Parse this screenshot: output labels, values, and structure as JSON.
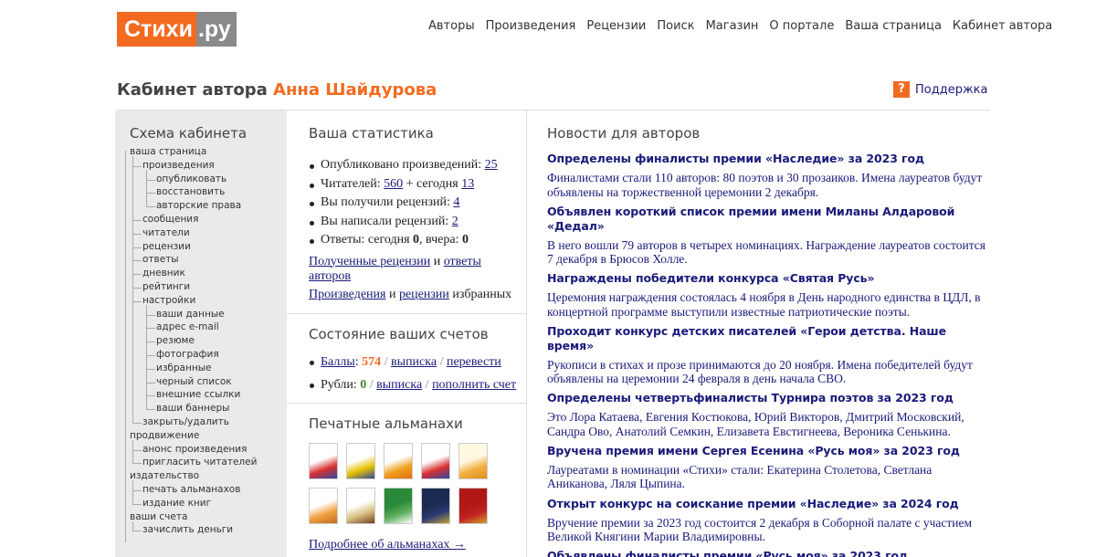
{
  "logo": {
    "part1": "Стихи",
    "part2": ".ру"
  },
  "nav": [
    "Авторы",
    "Произведения",
    "Рецензии",
    "Поиск",
    "Магазин",
    "О портале",
    "Ваша страница",
    "Кабинет автора"
  ],
  "cabinet": {
    "prefix": "Кабинет автора ",
    "author": "Анна Шайдурова"
  },
  "support": {
    "icon": "?",
    "label": "Поддержка"
  },
  "schema": {
    "title": "Схема кабинета",
    "items": [
      {
        "label": "ваша страница",
        "level": 0
      },
      {
        "label": "произведения",
        "level": 1
      },
      {
        "label": "опубликовать",
        "level": 2
      },
      {
        "label": "восстановить",
        "level": 2
      },
      {
        "label": "авторские права",
        "level": 2
      },
      {
        "label": "сообщения",
        "level": 1
      },
      {
        "label": "читатели",
        "level": 1
      },
      {
        "label": "рецензии",
        "level": 1
      },
      {
        "label": "ответы",
        "level": 1
      },
      {
        "label": "дневник",
        "level": 1
      },
      {
        "label": "рейтинги",
        "level": 1
      },
      {
        "label": "настройки",
        "level": 1
      },
      {
        "label": "ваши данные",
        "level": 2
      },
      {
        "label": "адрес e-mail",
        "level": 2
      },
      {
        "label": "резюме",
        "level": 2
      },
      {
        "label": "фотография",
        "level": 2
      },
      {
        "label": "избранные",
        "level": 2
      },
      {
        "label": "черный список",
        "level": 2
      },
      {
        "label": "внешние ссылки",
        "level": 2
      },
      {
        "label": "ваши баннеры",
        "level": 2
      },
      {
        "label": "закрыть/удалить",
        "level": 1
      },
      {
        "label": "продвижение",
        "level": 0
      },
      {
        "label": "анонс произведения",
        "level": 1
      },
      {
        "label": "пригласить читателей",
        "level": 1
      },
      {
        "label": "издательство",
        "level": 0
      },
      {
        "label": "печать альманахов",
        "level": 1
      },
      {
        "label": "издание книг",
        "level": 1
      },
      {
        "label": "ваши счета",
        "level": 0
      },
      {
        "label": "зачислить деньги",
        "level": 1
      }
    ]
  },
  "stats": {
    "title": "Ваша статистика",
    "published_label": "Опубликовано произведений: ",
    "published": "25",
    "readers_label": "Читателей: ",
    "readers_total": "560",
    "readers_mid": " + сегодня ",
    "readers_today": "13",
    "received_label": "Вы получили рецензий: ",
    "received": "4",
    "written_label": "Вы написали рецензий: ",
    "written": "2",
    "answers_label": "Ответы: сегодня ",
    "answers_today": "0",
    "answers_mid": ", вчера: ",
    "answers_yesterday": "0",
    "link_received": "Полученные рецензии",
    "and1": " и ",
    "link_answers": "ответы авторов",
    "link_works": "Произведения",
    "and2": " и ",
    "link_reviews": "рецензии",
    "favs": " избранных"
  },
  "accounts": {
    "title": "Состояние ваших счетов",
    "points_label": "Баллы",
    "points_sep": ": ",
    "points": "574",
    "points_statement": "выписка",
    "points_transfer": "перевести",
    "rubles_label": "Рубли: ",
    "rubles": "0",
    "rubles_statement": "выписка",
    "rubles_topup": "пополнить счет",
    "slash": " / "
  },
  "almanacs": {
    "title": "Печатные альманахи",
    "more": "Подробнее об альманахах →",
    "covers": [
      {
        "c1": "#ffffff",
        "c2": "#d93030",
        "c3": "#2a4aa0"
      },
      {
        "c1": "#ffffff",
        "c2": "#e6c000",
        "c3": "#2a4aa0"
      },
      {
        "c1": "#ffffff",
        "c2": "#f0a020",
        "c3": "#e07010"
      },
      {
        "c1": "#ffffff",
        "c2": "#d93030",
        "c3": "#2a4aa0"
      },
      {
        "c1": "#fff8e0",
        "c2": "#f0b040",
        "c3": "#e09020"
      },
      {
        "c1": "#ffffff",
        "c2": "#f0a040",
        "c3": "#c07020"
      },
      {
        "c1": "#ffffff",
        "c2": "#d8c080",
        "c3": "#704020"
      },
      {
        "c1": "#2a8a3a",
        "c2": "#60b060",
        "c3": "#ffffff"
      },
      {
        "c1": "#1a2a50",
        "c2": "#2a3a70",
        "c3": "#c0a040"
      },
      {
        "c1": "#b01818",
        "c2": "#c02020",
        "c3": "#d0a030"
      }
    ]
  },
  "news": {
    "title": "Новости для авторов",
    "items": [
      {
        "title": "Определены финалисты премии «Наследие» за 2023 год",
        "text": "Финалистами стали 110 авторов: 80 поэтов и 30 прозаиков. Имена лауреатов будут объявлены на торжественной церемонии 2 декабря."
      },
      {
        "title": "Объявлен короткий список премии имени Миланы Алдаровой «Дедал»",
        "text": "В него вошли 79 авторов в четырех номинациях. Награждение лауреатов состоится 7 декабря в Брюсов Холле."
      },
      {
        "title": "Награждены победители конкурса «Святая Русь»",
        "text": "Церемония награждения состоялась 4 ноября в День народного единства в ЦДЛ, в концертной программе выступили известные патриотические поэты."
      },
      {
        "title": "Проходит конкурс детских писателей «Герои детства. Наше время»",
        "text": "Рукописи в стихах и прозе принимаются до 20 ноября. Имена победителей будут объявлены на церемонии 24 февраля в день начала СВО."
      },
      {
        "title": "Определены четвертьфиналисты Турнира поэтов за 2023 год",
        "text": "Это Лора Катаева, Евгения Костюкова, Юрий Викторов, Дмитрий Московский, Сандра Ово, Анатолий Семкин, Елизавета Евстигнеева, Вероника Сенькина."
      },
      {
        "title": "Вручена премия имени Сергея Есенина «Русь моя» за 2023 год",
        "text": "Лауреатами в номинации «Стихи» стали: Екатерина Столетова, Светлана Аниканова, Ляля Цыпина."
      },
      {
        "title": "Открыт конкурс на соискание премии «Наследие» за 2024 год",
        "text": "Вручение премии за 2023 год состоится 2 декабря в Соборной палате с участием Великой Княгини Марии Владимировны."
      },
      {
        "title": "Объявлены финалисты премии «Русь моя» за 2023 год",
        "text": ""
      }
    ]
  }
}
